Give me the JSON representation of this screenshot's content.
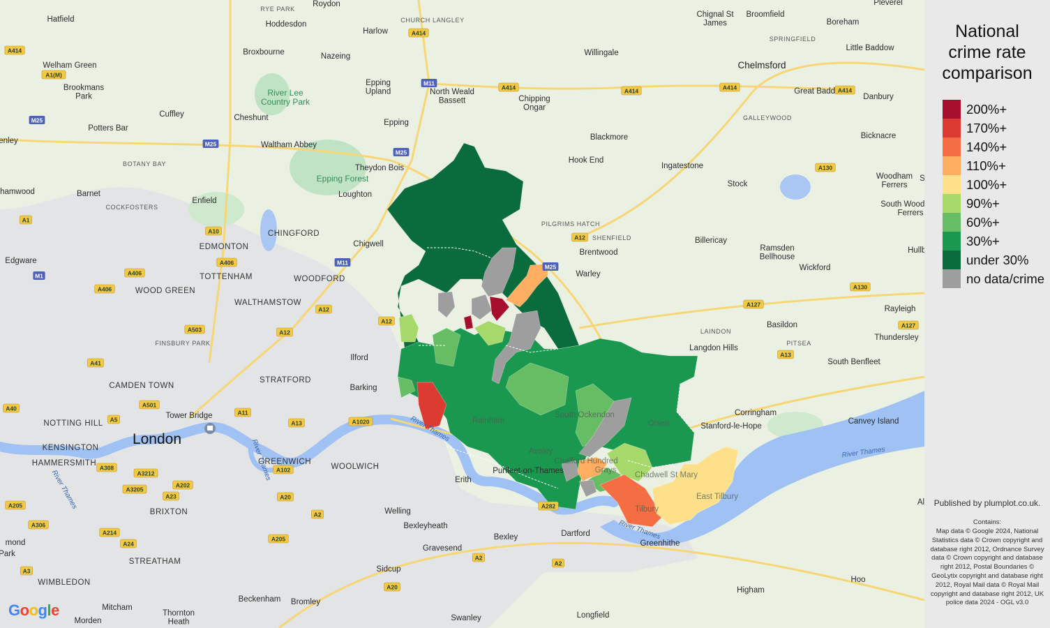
{
  "legend": {
    "title_lines": [
      "National",
      "crime rate",
      "comparison"
    ],
    "items": [
      {
        "label": "200%+",
        "color": "#a50f2d"
      },
      {
        "label": "170%+",
        "color": "#dc3b31"
      },
      {
        "label": "140%+",
        "color": "#f46d43"
      },
      {
        "label": "110%+",
        "color": "#fdae61"
      },
      {
        "label": "100%+",
        "color": "#fee08b"
      },
      {
        "label": "90%+",
        "color": "#a6d96a"
      },
      {
        "label": "60%+",
        "color": "#66bd63"
      },
      {
        "label": "30%+",
        "color": "#1a9850"
      },
      {
        "label": "under 30%",
        "color": "#0a6b3c"
      },
      {
        "label": "no data/crime",
        "color": "#9e9e9e"
      }
    ]
  },
  "published": "Published by plumplot.co.uk.",
  "contains_title": "Contains:",
  "attribution": "Map data © Google 2024, National Statistics data © Crown copyright and database right 2012, Ordnance Survey data © Crown copyright and database right 2012, Postal Boundaries © GeoLytix copyright and database right 2012, Royal Mail data © Royal Mail copyright and database right 2012, UK police data 2024 - OGL v3.0",
  "google_logo": [
    "G",
    "o",
    "o",
    "g",
    "l",
    "e"
  ],
  "google_colors": [
    "#4285f4",
    "#ea4335",
    "#fbbc05",
    "#4285f4",
    "#34a853",
    "#ea4335"
  ],
  "map": {
    "big_label": "London",
    "medium_labels": [
      "Chelmsford"
    ],
    "places": [
      "Hatfield",
      "Hoddesdon",
      "Roydon",
      "Harlow",
      "Broxbourne",
      "Nazeing",
      "Epping Upland",
      "North Weald Bassett",
      "Chipping Ongar",
      "Willingale",
      "Chignal St James",
      "Broomfield",
      "Boreham",
      "Pleverel",
      "Little Baddow",
      "Great Baddow",
      "Danbury",
      "Welham Green",
      "Brookmans Park",
      "Cuffley",
      "Cheshunt",
      "Potters Bar",
      "Waltham Abbey",
      "Epping",
      "Theydon Bois",
      "Loughton",
      "Chigwell",
      "Barnet",
      "Enfield",
      "Edgware",
      "Ilford",
      "Barking",
      "Erith",
      "Welling",
      "Bexleyheath",
      "Bexley",
      "Dartford",
      "Greenhithe",
      "Gravesend",
      "Sidcup",
      "Swanley",
      "Longfield",
      "Beckenham",
      "Bromley",
      "Mitcham",
      "Morden",
      "Thornton Heath",
      "Higham",
      "Hoo",
      "Blackmore",
      "Hook End",
      "Ingatestone",
      "Stock",
      "Brentwood",
      "Warley",
      "Billericay",
      "Ramsden Bellhouse",
      "Wickford",
      "Rayleigh",
      "Basildon",
      "Langdon Hills",
      "Thundersley",
      "South Benfleet",
      "Canvey Island",
      "Corringham",
      "Stanford-le-Hope",
      "Bicknacre",
      "Woodham Ferrers",
      "South Woodham Ferrers",
      "Hullbridge",
      "Purfleet-on-Thames",
      "Tower Bridge",
      "enley",
      "hamwood"
    ],
    "caps_places": [
      "EDMONTON",
      "TOTTENHAM",
      "WOOD GREEN",
      "WALTHAMSTOW",
      "WOODFORD",
      "CHINGFORD",
      "STRATFORD",
      "CAMDEN TOWN",
      "NOTTING HILL",
      "KENSINGTON",
      "HAMMERSMITH",
      "GREENWICH",
      "WOOLWICH",
      "BRIXTON",
      "STREATHAM",
      "WIMBLEDON"
    ],
    "small_places": [
      "RYE PARK",
      "CHURCH LANGLEY",
      "BOTANY BAY",
      "COCKFOSTERS",
      "FINSBURY PARK",
      "PILGRIMS HATCH",
      "SHENFIELD",
      "LAINDON",
      "PITSEA",
      "GALLEYWOOD",
      "SPRINGFIELD"
    ],
    "green_places": [
      "River Lee Country Park",
      "Epping Forest"
    ],
    "river_labels": [
      "River Thames",
      "River Thames",
      "River Thames",
      "River Thames",
      "River Thames"
    ],
    "on_area_labels": [
      "Rainham",
      "South Ockendon",
      "Aveley",
      "Grays",
      "Chafford Hundred",
      "Orsett",
      "Chadwell St Mary",
      "East Tilbury",
      "Tilbury"
    ],
    "partial_labels": [
      "mond",
      "Park",
      "Al",
      "S"
    ],
    "road_shields": [
      "A414",
      "A414",
      "A414",
      "A414",
      "A414",
      "A414",
      "A1(M)",
      "A1",
      "A10",
      "A406",
      "A406",
      "A406",
      "A12",
      "A12",
      "A12",
      "A12",
      "A13",
      "A13",
      "A13",
      "A1020",
      "A11",
      "A503",
      "A501",
      "A41",
      "A40",
      "A5",
      "A308",
      "A3212",
      "A3205",
      "A202",
      "A23",
      "A205",
      "A205",
      "A306",
      "A214",
      "A24",
      "A20",
      "A20",
      "A2",
      "A2",
      "A2",
      "A282",
      "A102",
      "A127",
      "A127",
      "A130",
      "A130",
      "A3"
    ],
    "motorway_shields": [
      "M25",
      "M25",
      "M25",
      "M25",
      "M11",
      "M11",
      "M1"
    ]
  }
}
